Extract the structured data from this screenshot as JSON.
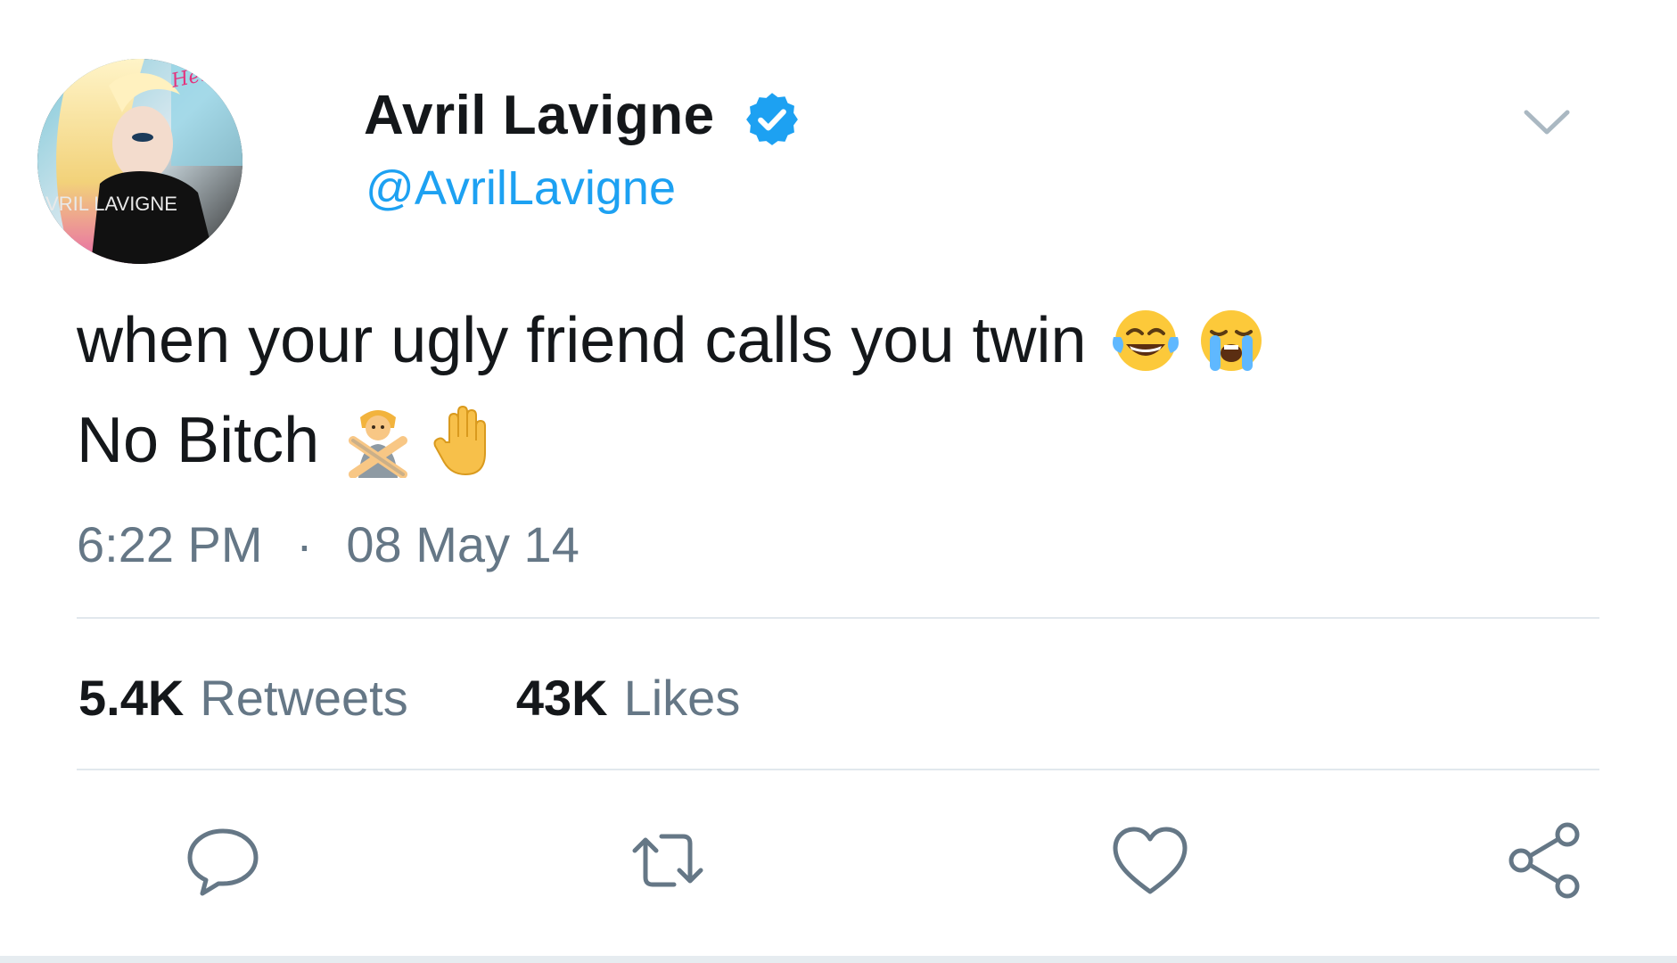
{
  "tweet": {
    "author": {
      "display_name": "Avril Lavigne",
      "handle": "@AvrilLavigne",
      "verified": true,
      "avatar_text_top": "Hello Kitty",
      "avatar_text_bottom": "AVRIL LAVIGNE"
    },
    "text": {
      "line1": "when your ugly friend calls you twin",
      "line1_emojis": [
        "face-with-tears-of-joy",
        "loudly-crying-face"
      ],
      "line2": "No Bitch",
      "line2_emojis": [
        "person-gesturing-no",
        "raised-hand"
      ]
    },
    "time": "6:22 PM",
    "separator": "·",
    "date": "08 May 14",
    "stats": {
      "retweets_count": "5.4K",
      "retweets_label": "Retweets",
      "likes_count": "43K",
      "likes_label": "Likes"
    },
    "actions": [
      "reply",
      "retweet",
      "like",
      "share"
    ]
  },
  "colors": {
    "text_primary": "#14171a",
    "text_secondary": "#657786",
    "accent": "#1da1f2",
    "divider": "#e1e8ed",
    "icon": "#657786"
  },
  "icons": {
    "verified": "verified-badge-icon",
    "menu": "chevron-down-icon",
    "reply": "reply-bubble-icon",
    "retweet": "retweet-arrows-icon",
    "like": "heart-icon",
    "share": "share-nodes-icon"
  }
}
